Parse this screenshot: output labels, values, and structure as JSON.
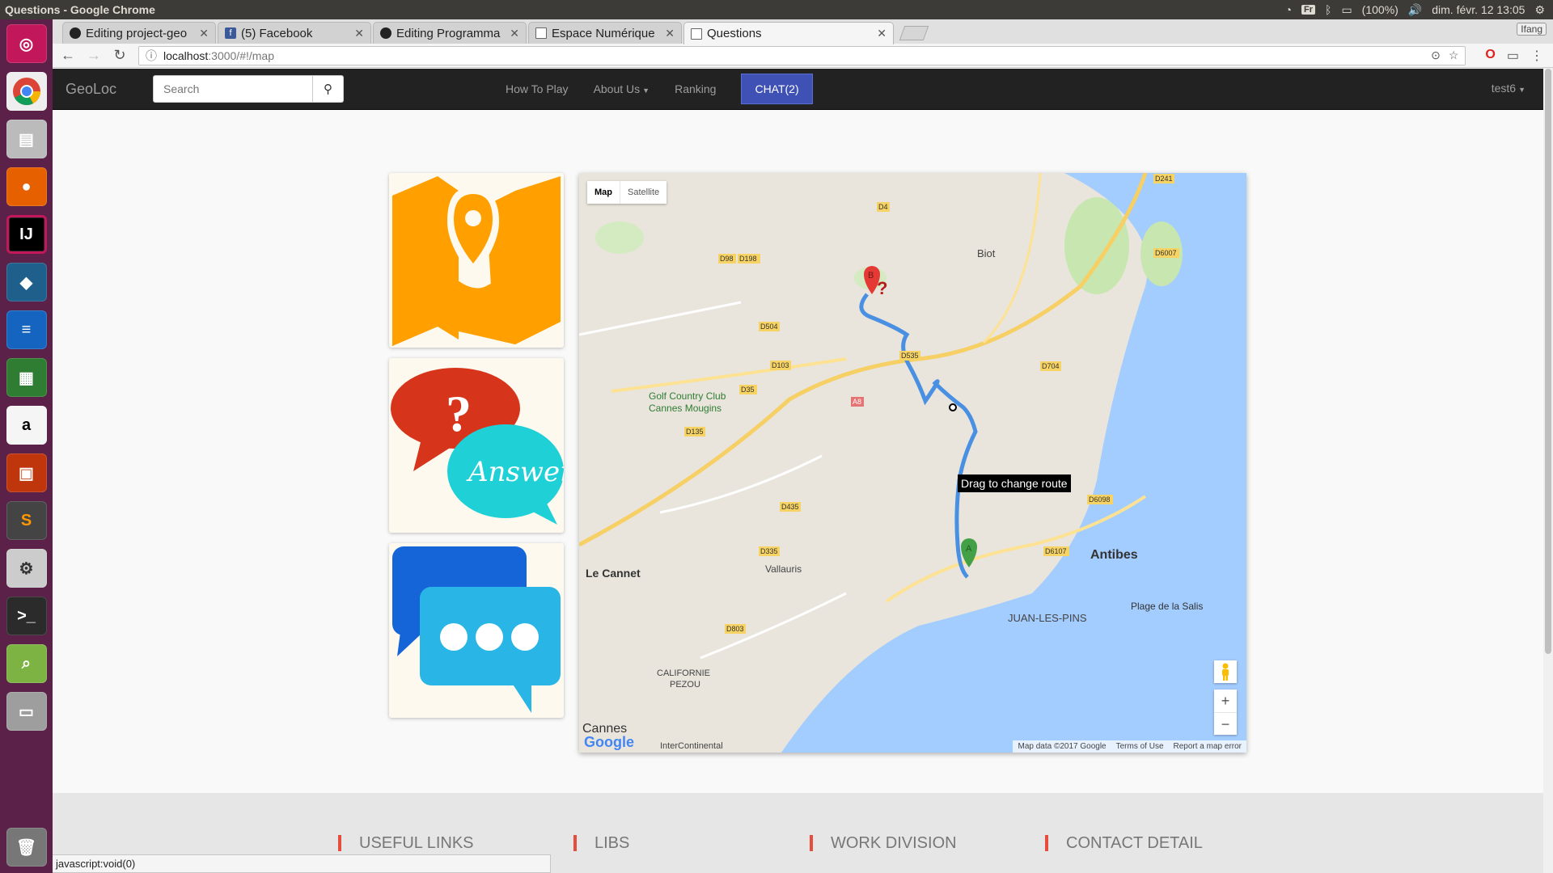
{
  "os": {
    "window_title": "Questions - Google Chrome",
    "keyboard": "Fr",
    "battery": "(100%)",
    "datetime": "dim. févr. 12 13:05"
  },
  "browser": {
    "profile": "Ifang",
    "tabs": [
      {
        "label": "Editing project-geo",
        "icon": "github-icon"
      },
      {
        "label": "(5) Facebook",
        "icon": "facebook-icon"
      },
      {
        "label": "Editing Programma",
        "icon": "github-icon"
      },
      {
        "label": "Espace Numérique",
        "icon": "page-icon"
      },
      {
        "label": "Questions",
        "icon": "page-icon"
      }
    ],
    "url_host": "localhost",
    "url_path": ":3000/#!/map",
    "status_text": "javascript:void(0)"
  },
  "navbar": {
    "brand": "GeoLoc",
    "search_placeholder": "Search",
    "links": [
      "How To Play",
      "About Us",
      "Ranking"
    ],
    "chat": "CHAT(2)",
    "user": "test6"
  },
  "map": {
    "type_map": "Map",
    "type_satellite": "Satellite",
    "tooltip": "Drag to change route",
    "marker_start": "A",
    "marker_end": "B",
    "places": [
      "Biot",
      "Golf Country Club",
      "Cannes Mougins",
      "Antibes",
      "Le Cannet",
      "Vallauris",
      "JUAN-LES-PINS",
      "Plage de la Salis",
      "CALIFORNIE",
      "PEZOU",
      "Cannes",
      "InterContinental"
    ],
    "roads": [
      "D241",
      "D4",
      "D198",
      "D98",
      "D6007",
      "D504",
      "D103",
      "D35",
      "D535",
      "D704",
      "A8",
      "D135",
      "D435",
      "D6098",
      "D335",
      "D6107",
      "D803"
    ],
    "attribution": [
      "Map data ©2017 Google",
      "Terms of Use",
      "Report a map error"
    ],
    "logo": "Google"
  },
  "footer": {
    "headings": [
      "USEFUL LINKS",
      "LIBS",
      "WORK DIVISION",
      "CONTACT DETAIL"
    ]
  }
}
